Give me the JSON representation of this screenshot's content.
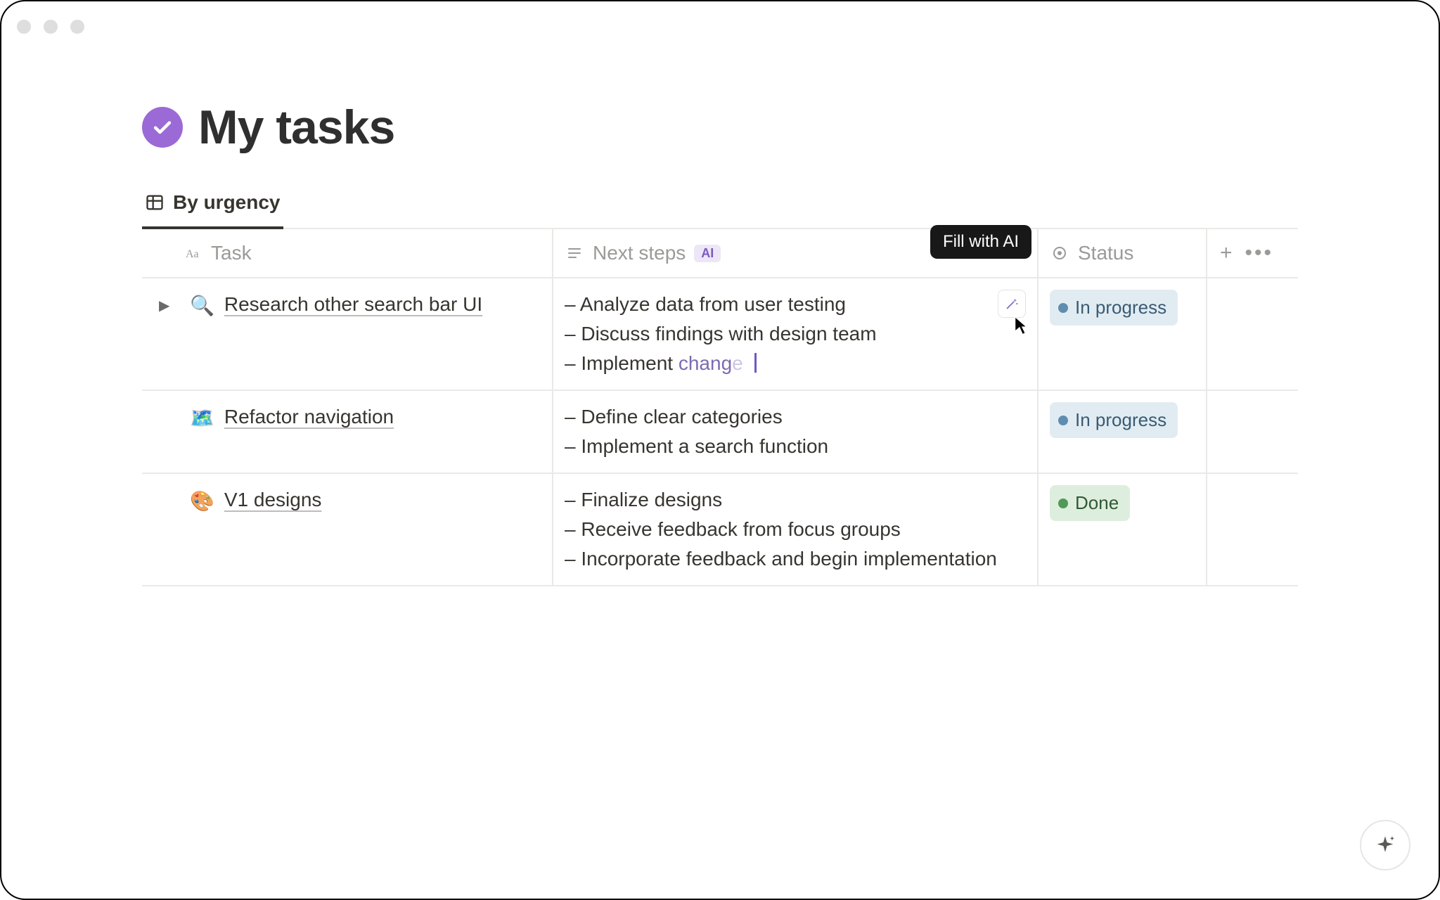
{
  "page": {
    "title": "My tasks"
  },
  "views": {
    "active": "By urgency"
  },
  "columns": {
    "task": "Task",
    "next": "Next steps",
    "ai_badge": "AI",
    "status": "Status"
  },
  "tooltip": {
    "fill_with_ai": "Fill with AI"
  },
  "status_labels": {
    "in_progress": "In progress",
    "done": "Done"
  },
  "rows": [
    {
      "emoji": "🔍",
      "title": "Research other search bar UI",
      "expandable": true,
      "next_steps": [
        "– Analyze data from user testing",
        "– Discuss findings with design team"
      ],
      "typing_prefix": "– Implement ",
      "typing_mid": "chang",
      "typing_fade": "e",
      "status": "in_progress",
      "show_wand": true
    },
    {
      "emoji": "🗺️",
      "title": "Refactor navigation",
      "expandable": false,
      "next_steps": [
        "– Define clear categories",
        "– Implement a search function"
      ],
      "status": "in_progress",
      "show_wand": false
    },
    {
      "emoji": "🎨",
      "title": "V1 designs",
      "expandable": false,
      "next_steps": [
        "– Finalize designs",
        "– Receive feedback from focus groups",
        "– Incorporate feedback and begin implementation"
      ],
      "status": "done",
      "show_wand": false
    }
  ]
}
